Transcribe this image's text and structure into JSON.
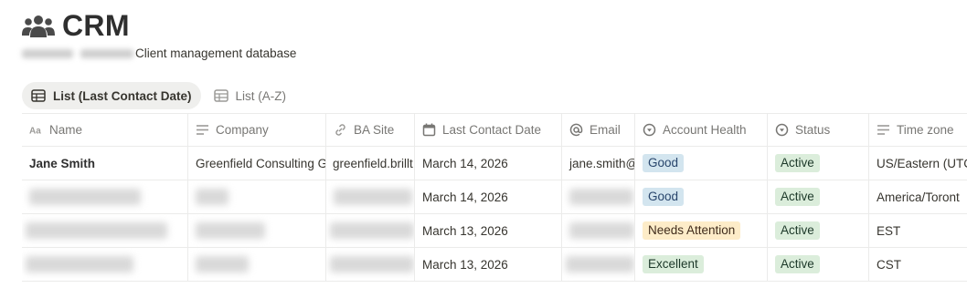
{
  "page": {
    "title": "CRM",
    "title_icon": "people-group-icon",
    "subtitle": "Client management database"
  },
  "tabs": [
    {
      "label": "List (Last Contact Date)",
      "icon": "table-icon",
      "active": true
    },
    {
      "label": "List (A-Z)",
      "icon": "table-icon",
      "active": false
    }
  ],
  "columns": [
    {
      "label": "Name",
      "icon": "text-property-icon"
    },
    {
      "label": "Company",
      "icon": "lines-property-icon"
    },
    {
      "label": "BA Site",
      "icon": "link-icon"
    },
    {
      "label": "Last Contact Date",
      "icon": "calendar-icon"
    },
    {
      "label": "Email",
      "icon": "at-sign-icon"
    },
    {
      "label": "Account Health",
      "icon": "select-circle-icon"
    },
    {
      "label": "Status",
      "icon": "status-circle-icon"
    },
    {
      "label": "Time zone",
      "icon": "lines-property-icon"
    }
  ],
  "rows": [
    {
      "name": "Jane Smith",
      "company": "Greenfield Consulting G",
      "ba_site": "greenfield.brillt",
      "last_contact": "March 14, 2026",
      "email": "jane.smith@",
      "health": "Good",
      "status": "Active",
      "timezone": "US/Eastern (UTC"
    },
    {
      "name": "",
      "company": "",
      "ba_site": "",
      "last_contact": "March 14, 2026",
      "email": "",
      "health": "Good",
      "status": "Active",
      "timezone": "America/Toront"
    },
    {
      "name": "",
      "company": "",
      "ba_site": "",
      "last_contact": "March 13, 2026",
      "email": "",
      "health": "Needs Attention",
      "status": "Active",
      "timezone": "EST"
    },
    {
      "name": "",
      "company": "",
      "ba_site": "",
      "last_contact": "March 13, 2026",
      "email": "",
      "health": "Excellent",
      "status": "Active",
      "timezone": "CST"
    }
  ],
  "colors": {
    "health_good": "#d3e5ef",
    "health_needs_attention": "#fdecc8",
    "health_excellent": "#dbeddb",
    "status_active": "#dbeddb"
  }
}
